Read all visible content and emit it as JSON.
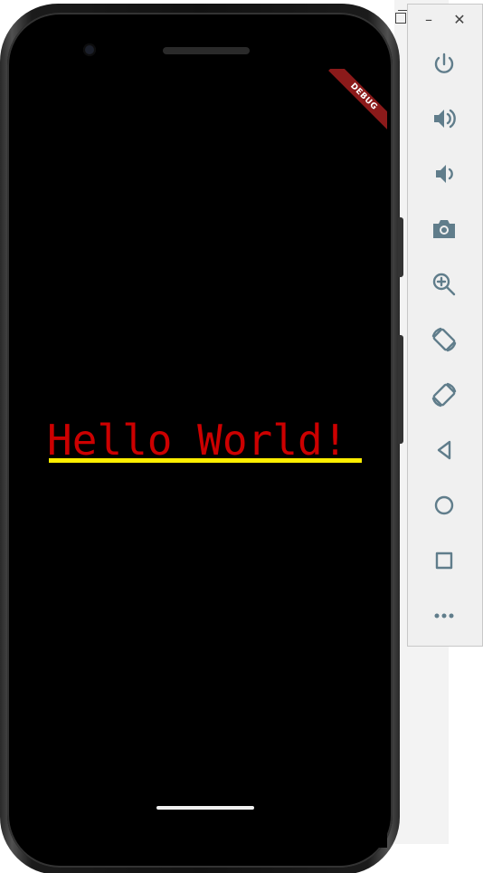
{
  "app": {
    "display_text": "Hello World!",
    "debug_banner": "DEBUG"
  },
  "colors": {
    "text": "#cc0000",
    "underline": "#ffee00",
    "screen_background": "#000000",
    "toolbar_icon": "#607d8b"
  },
  "toolbar": {
    "minimize_label": "–",
    "close_label": "✕",
    "items": [
      {
        "icon": "power-icon"
      },
      {
        "icon": "volume-up-icon"
      },
      {
        "icon": "volume-down-icon"
      },
      {
        "icon": "camera-icon"
      },
      {
        "icon": "zoom-icon"
      },
      {
        "icon": "rotate-left-icon"
      },
      {
        "icon": "rotate-right-icon"
      },
      {
        "icon": "back-icon"
      },
      {
        "icon": "home-icon"
      },
      {
        "icon": "overview-icon"
      },
      {
        "icon": "more-icon"
      }
    ]
  }
}
